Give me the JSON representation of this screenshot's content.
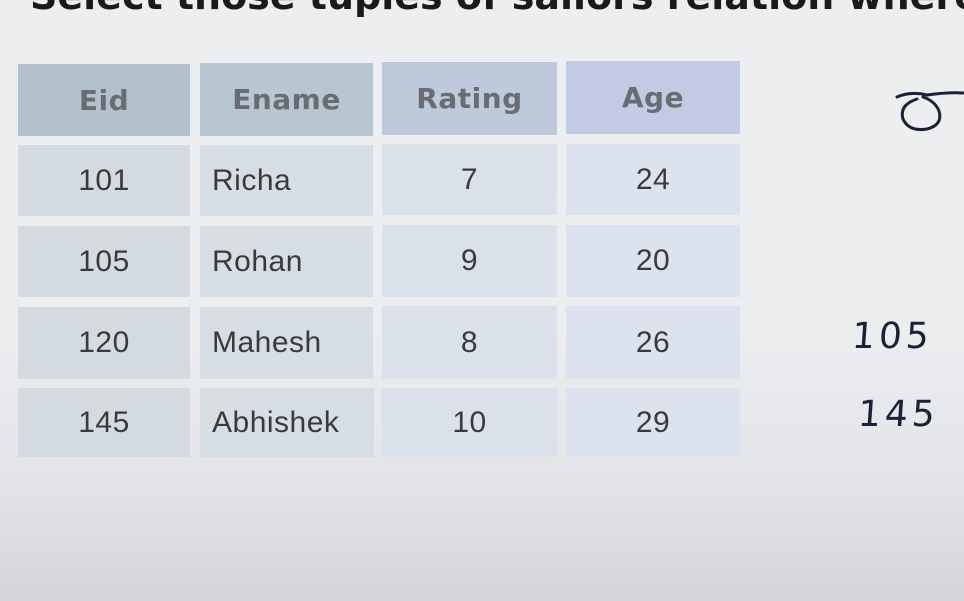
{
  "title": "Select those tuples of sailors relation where",
  "table": {
    "headers": [
      "Eid",
      "Ename",
      "Rating",
      "Age"
    ],
    "rows": [
      [
        "101",
        "Richa",
        "7",
        "24"
      ],
      [
        "105",
        "Rohan",
        "9",
        "20"
      ],
      [
        "120",
        "Mahesh",
        "8",
        "26"
      ],
      [
        "145",
        "Abhishek",
        "10",
        "29"
      ]
    ]
  },
  "annotations": {
    "symbol_icon": "sigma-icon",
    "notes": [
      "105",
      "145"
    ]
  }
}
